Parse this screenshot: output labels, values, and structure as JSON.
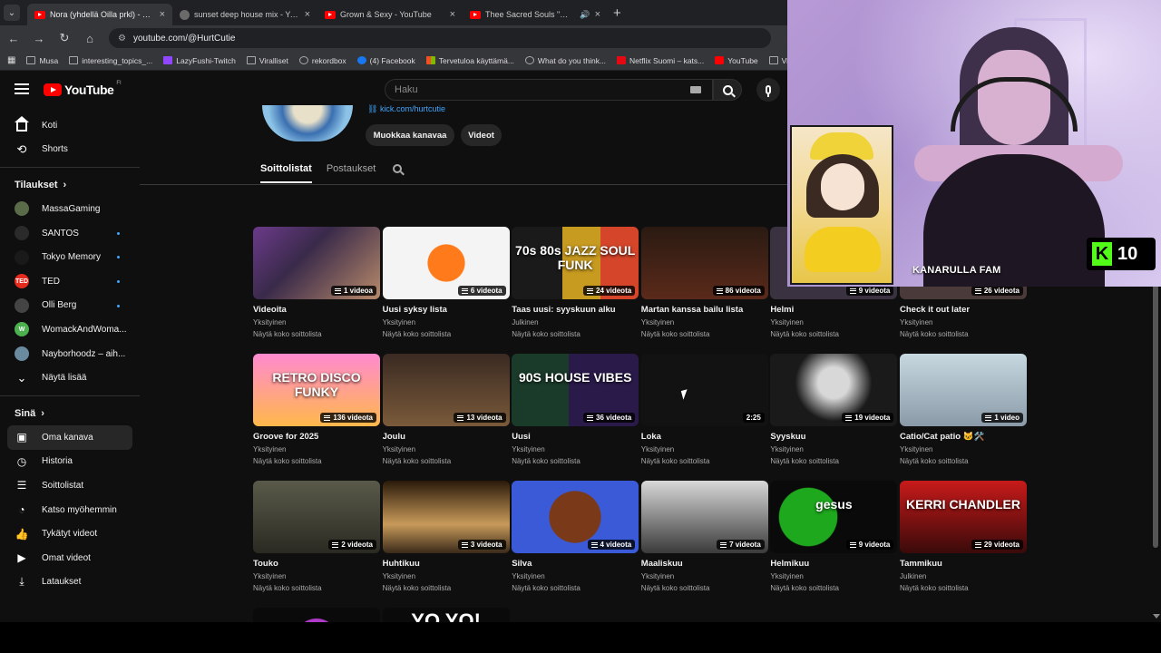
{
  "browser": {
    "tabs": [
      {
        "title": "Nora (yhdellä Oilla prkl) - YouTube",
        "favicon": "youtube-icon",
        "active": true
      },
      {
        "title": "sunset deep house mix - YouTube",
        "favicon": "globe-icon",
        "active": false
      },
      {
        "title": "Grown & Sexy - YouTube",
        "favicon": "youtube-icon",
        "active": false
      },
      {
        "title": "Thee Sacred Souls \"Will I See...",
        "favicon": "youtube-icon",
        "active": false,
        "audio": true
      }
    ],
    "url": "youtube.com/@HurtCutie",
    "bookmarks": [
      {
        "label": "Musa",
        "icon": "folder"
      },
      {
        "label": "interesting_topics_...",
        "icon": "folder"
      },
      {
        "label": "LazyFushi-Twitch",
        "icon": "tw"
      },
      {
        "label": "Viralliset",
        "icon": "folder"
      },
      {
        "label": "rekordbox",
        "icon": "gb"
      },
      {
        "label": "(4) Facebook",
        "icon": "f"
      },
      {
        "label": "Tervetuloa käyttämä...",
        "icon": "ms"
      },
      {
        "label": "What do you think...",
        "icon": "gb"
      },
      {
        "label": "Netflix Suomi – kats...",
        "icon": "nf"
      },
      {
        "label": "YouTube",
        "icon": "yt"
      },
      {
        "label": "Virallin",
        "icon": "folder"
      }
    ]
  },
  "youtube": {
    "logo_text": "YouTube",
    "region": "FI",
    "search_placeholder": "Haku"
  },
  "sidebar": {
    "main": [
      {
        "label": "Koti",
        "icon": "home-icon"
      },
      {
        "label": "Shorts",
        "icon": "shorts-icon"
      }
    ],
    "subscriptions_title": "Tilaukset",
    "subscriptions": [
      {
        "label": "MassaGaming",
        "color": "#5a6b4a",
        "initial": "",
        "dot": false
      },
      {
        "label": "SANTOS",
        "color": "#2a2a2a",
        "initial": "",
        "dot": true
      },
      {
        "label": "Tokyo Memory",
        "color": "#1a1a1a",
        "initial": "",
        "dot": true
      },
      {
        "label": "TED",
        "color": "#e62b1e",
        "initial": "TED",
        "dot": true
      },
      {
        "label": "Olli Berg",
        "color": "#444444",
        "initial": "",
        "dot": true
      },
      {
        "label": "WomackAndWoma...",
        "color": "#4caf50",
        "initial": "W",
        "dot": false
      },
      {
        "label": "Nayborhoodz – aih...",
        "color": "#6a8aa0",
        "initial": "",
        "dot": false
      }
    ],
    "show_more": "Näytä lisää",
    "you_title": "Sinä",
    "you": [
      {
        "label": "Oma kanava",
        "icon": "channel-icon",
        "active": true
      },
      {
        "label": "Historia",
        "icon": "history-icon",
        "active": false
      },
      {
        "label": "Soittolistat",
        "icon": "playlists-icon",
        "active": false
      },
      {
        "label": "Katso myöhemmin",
        "icon": "watch-later-icon",
        "active": false
      },
      {
        "label": "Tykätyt videot",
        "icon": "like-icon",
        "active": false
      },
      {
        "label": "Omat videot",
        "icon": "my-videos-icon",
        "active": false
      },
      {
        "label": "Lataukset",
        "icon": "download-icon",
        "active": false
      }
    ]
  },
  "channel": {
    "link": "kick.com/hurtcutie",
    "edit_button": "Muokkaa kanavaa",
    "videos_button": "Videot",
    "tabs": [
      "Soittolistat",
      "Postaukset"
    ]
  },
  "playlists": [
    {
      "title": "Videoita",
      "visibility": "Yksityinen",
      "more": "Näytä koko soittolista",
      "count": "1 videoa",
      "bg": "linear-gradient(135deg,#6b3a8a,#3a2a4a 40%,#b88a6a)",
      "overlay": ""
    },
    {
      "title": "Uusi syksy lista",
      "visibility": "Yksityinen",
      "more": "Näytä koko soittolista",
      "count": "6 videota",
      "bg": "radial-gradient(circle at 50% 50%,#ff7a1a 0 25%,#f4f4f4 26%)",
      "overlay": ""
    },
    {
      "title": "Taas uusi: syyskuun alku",
      "visibility": "Julkinen",
      "more": "Näytä koko soittolista",
      "count": "24 videota",
      "bg": "linear-gradient(90deg,#1a1a1a 0 40%,#c79a20 40% 70%,#d4452a 70%)",
      "overlay": "70s 80s JAZZ SOUL FUNK"
    },
    {
      "title": "Martan kanssa bailu lista",
      "visibility": "Yksityinen",
      "more": "Näytä koko soittolista",
      "count": "86 videota",
      "bg": "linear-gradient(180deg,#2a1a12,#5a2a1a)",
      "overlay": ""
    },
    {
      "title": "Helmi",
      "visibility": "Yksityinen",
      "more": "Näytä koko soittolista",
      "count": "9 videota",
      "bg": "#3a3240",
      "overlay": ""
    },
    {
      "title": "Check it out later",
      "visibility": "Yksityinen",
      "more": "Näytä koko soittolista",
      "count": "26 videota",
      "bg": "#4a3a3a",
      "overlay": ""
    },
    {
      "title": "Groove for 2025",
      "visibility": "Yksityinen",
      "more": "Näytä koko soittolista",
      "count": "136 videota",
      "bg": "linear-gradient(180deg,#ff8ad0,#ffb84a)",
      "overlay": "RETRO DISCO FUNKY"
    },
    {
      "title": "Joulu",
      "visibility": "Yksityinen",
      "more": "Näytä koko soittolista",
      "count": "13 videota",
      "bg": "linear-gradient(180deg,#3a2a22,#7a5a3a)",
      "overlay": ""
    },
    {
      "title": "Uusi",
      "visibility": "Yksityinen",
      "more": "Näytä koko soittolista",
      "count": "36 videota",
      "bg": "linear-gradient(90deg,#1a3a2a 0 45%,#2a1a4a 45%)",
      "overlay": "90S HOUSE VIBES"
    },
    {
      "title": "Loka",
      "visibility": "Yksityinen",
      "more": "Näytä koko soittolista",
      "count": "2:25",
      "bg": "#121212",
      "overlay": ""
    },
    {
      "title": "Syyskuu",
      "visibility": "Yksityinen",
      "more": "Näytä koko soittolista",
      "count": "19 videota",
      "bg": "radial-gradient(circle at 50% 40%,#d8d8d8 0 20%,#1a1a1a 50%)",
      "overlay": ""
    },
    {
      "title": "Catio/Cat patio 🐱🛠️",
      "visibility": "Yksityinen",
      "more": "Näytä koko soittolista",
      "count": "1 video",
      "bg": "linear-gradient(180deg,#c8d8e0,#8a9aa8)",
      "overlay": ""
    },
    {
      "title": "Touko",
      "visibility": "Yksityinen",
      "more": "Näytä koko soittolista",
      "count": "2 videota",
      "bg": "linear-gradient(180deg,#5a5a4a,#2a2a22)",
      "overlay": ""
    },
    {
      "title": "Huhtikuu",
      "visibility": "Yksityinen",
      "more": "Näytä koko soittolista",
      "count": "3 videota",
      "bg": "linear-gradient(180deg,#2a1a0a,#c89a5a 60%,#3a2a1a)",
      "overlay": ""
    },
    {
      "title": "Silva",
      "visibility": "Yksityinen",
      "more": "Näytä koko soittolista",
      "count": "4 videota",
      "bg": "radial-gradient(circle at 50% 50%,#7a3a1a 0 35%,#3a5ad8 36%)",
      "overlay": ""
    },
    {
      "title": "Maaliskuu",
      "visibility": "Yksityinen",
      "more": "Näytä koko soittolista",
      "count": "7 videota",
      "bg": "linear-gradient(180deg,#d8d8d8,#3a3a3a)",
      "overlay": ""
    },
    {
      "title": "Helmikuu",
      "visibility": "Yksityinen",
      "more": "Näytä koko soittolista",
      "count": "9 videota",
      "bg": "radial-gradient(circle at 30% 50%,#1ea81e 0 30%,#0a0a0a 31%)",
      "overlay": "gesus"
    },
    {
      "title": "Tammikuu",
      "visibility": "Julkinen",
      "more": "Näytä koko soittolista",
      "count": "29 videota",
      "bg": "linear-gradient(180deg,#c81a1a,#3a0a0a)",
      "overlay": "KERRI CHANDLER"
    }
  ],
  "partial_row": [
    {
      "bg": "radial-gradient(circle at 50% 90%,#b03ac8 0 30%,#0a0a0a 31%)",
      "overlay": ""
    },
    {
      "bg": "#0a0a0a",
      "overlay": "YO YO!"
    }
  ],
  "stream": {
    "kick_count": "10",
    "label": "KANARULLA FAM"
  }
}
